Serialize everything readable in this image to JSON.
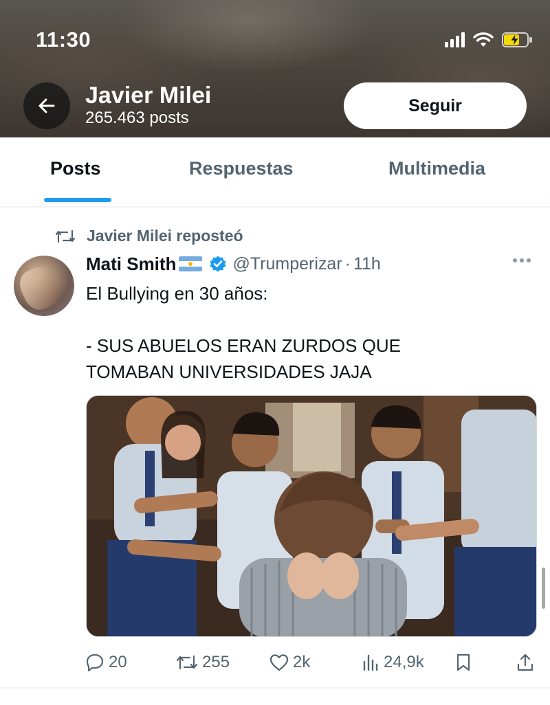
{
  "status_bar": {
    "time": "11:30"
  },
  "profile_header": {
    "name": "Javier Milei",
    "posts_count": "265.463 posts",
    "follow_label": "Seguir"
  },
  "tabs": [
    {
      "label": "Posts",
      "active": true
    },
    {
      "label": "Respuestas",
      "active": false
    },
    {
      "label": "Multimedia",
      "active": false
    }
  ],
  "post": {
    "repost_label": "Javier Milei reposteó",
    "author_name": "Mati Smith",
    "author_flag": "argentina-flag",
    "verified": true,
    "handle": "@Trumperizar",
    "separator": "·",
    "time": "11h",
    "text_lines": [
      "El Bullying en 30 años:",
      "",
      "- SUS ABUELOS ERAN ZURDOS QUE",
      "TOMABAN UNIVERSIDADES JAJA"
    ],
    "actions": {
      "replies": "20",
      "reposts": "255",
      "likes": "2k",
      "views": "24,9k"
    }
  },
  "colors": {
    "accent": "#1d9bf0",
    "text_primary": "#0f1419",
    "text_secondary": "#536471"
  }
}
